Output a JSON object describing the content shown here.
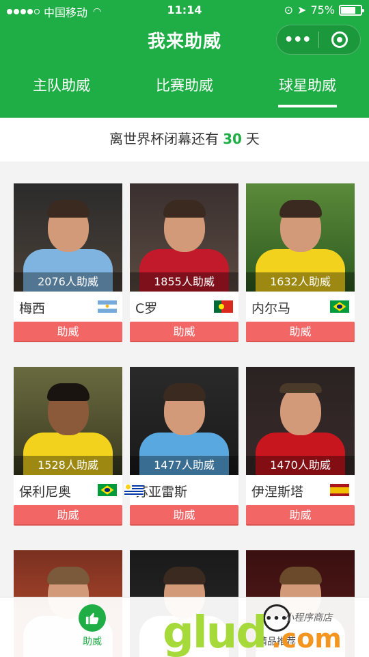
{
  "status_bar": {
    "carrier": "中国移动",
    "time": "11:14",
    "battery": "75%",
    "battery_level": 0.75
  },
  "header": {
    "title": "我来助威",
    "capsule_more": "•••",
    "icons": [
      "more-icon",
      "close-ring-icon"
    ]
  },
  "tabs": [
    {
      "label": "主队助威",
      "active": false
    },
    {
      "label": "比赛助威",
      "active": false
    },
    {
      "label": "球星助威",
      "active": true
    }
  ],
  "countdown": {
    "prefix": "离世界杯闭幕还有",
    "days": "30",
    "suffix": "天"
  },
  "players": [
    {
      "name": "梅西",
      "count": "2076人助威",
      "button": "助威",
      "flag": "argentina",
      "shirt": "#7fb4e0"
    },
    {
      "name": "C罗",
      "count": "1855人助威",
      "button": "助威",
      "flag": "portugal",
      "shirt": "#c21a2a"
    },
    {
      "name": "内尔马",
      "count": "1632人助威",
      "button": "助威",
      "flag": "brazil",
      "shirt": "#f2d21c"
    },
    {
      "name": "保利尼奥",
      "count": "1528人助威",
      "button": "助威",
      "flag": "brazil",
      "shirt": "#f2d21c"
    },
    {
      "name": "苏亚雷斯",
      "count": "1477人助威",
      "button": "助威",
      "flag": "uruguay",
      "shirt": "#5aa8e0"
    },
    {
      "name": "伊涅斯塔",
      "count": "1470人助威",
      "button": "助威",
      "flag": "spain",
      "shirt": "#c8161e"
    },
    {
      "name": "",
      "count": "",
      "button": "",
      "flag": "",
      "shirt": "#eeeeee"
    },
    {
      "name": "",
      "count": "",
      "button": "",
      "flag": "",
      "shirt": "#f2f2f2"
    },
    {
      "name": "",
      "count": "",
      "button": "",
      "flag": "",
      "shirt": "#f2f2f2"
    }
  ],
  "tab_bar": {
    "items": [
      {
        "label": "助威",
        "icon": "thumbs-up-icon",
        "active": true
      },
      {
        "label": "精品推荐",
        "icon": "chat-dots-icon",
        "active": false
      }
    ]
  },
  "watermark": {
    "logo": "glud",
    "com": ".com",
    "tagline": "小程序商店"
  },
  "colors": {
    "primary_green": "#1fae45",
    "button_red": "#f26766",
    "background": "#f3f3f3"
  }
}
